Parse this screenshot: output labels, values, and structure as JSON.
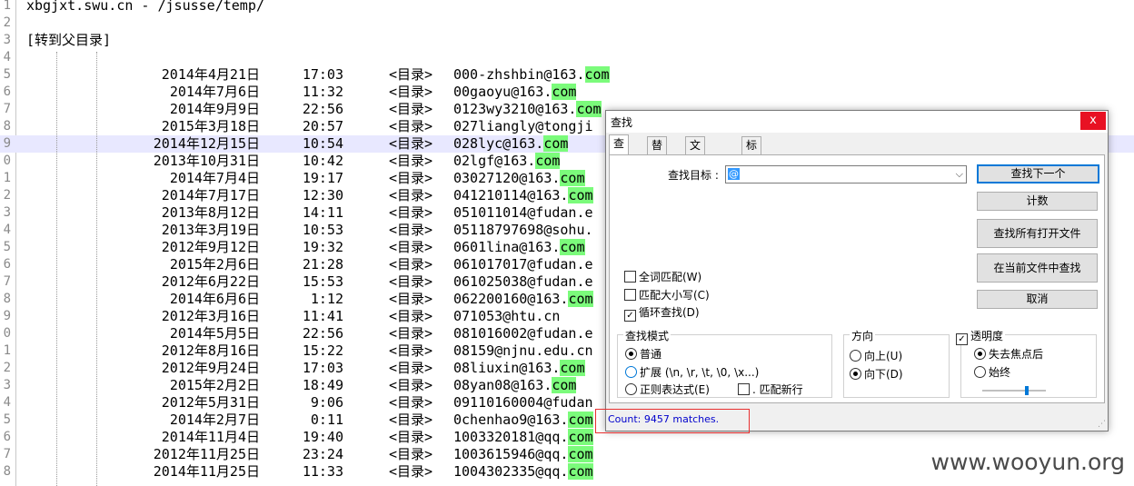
{
  "editor": {
    "header_line": "xbgjxt.swu.cn - /jsusse/temp/",
    "parent_link": "[转到父目录]",
    "dir_label": "<目录>",
    "highlight": "com",
    "current_line": 9,
    "rows": [
      {
        "ln": "5",
        "date": "2014年4月21日",
        "time": "17:03",
        "pre": "000-zhshbin@163.",
        "hl": true
      },
      {
        "ln": "6",
        "date": "2014年7月6日",
        "time": "11:32",
        "pre": "00gaoyu@163.",
        "hl": true
      },
      {
        "ln": "7",
        "date": "2014年9月9日",
        "time": "22:56",
        "pre": "0123wy3210@163.",
        "hl": true
      },
      {
        "ln": "8",
        "date": "2015年3月18日",
        "time": "20:57",
        "pre": "027liangly@tongji",
        "hl": false
      },
      {
        "ln": "9",
        "date": "2014年12月15日",
        "time": "10:54",
        "pre": "028lyc@163.",
        "hl": true
      },
      {
        "ln": "0",
        "date": "2013年10月31日",
        "time": "10:42",
        "pre": "02lgf@163.",
        "hl": true
      },
      {
        "ln": "1",
        "date": "2014年7月4日",
        "time": "19:17",
        "pre": "03027120@163.",
        "hl": true
      },
      {
        "ln": "2",
        "date": "2014年7月17日",
        "time": "12:30",
        "pre": "041210114@163.",
        "hl": true
      },
      {
        "ln": "3",
        "date": "2013年8月12日",
        "time": "14:11",
        "pre": "051011014@fudan.e",
        "hl": false
      },
      {
        "ln": "4",
        "date": "2013年3月19日",
        "time": "10:53",
        "pre": "05118797698@sohu.",
        "hl": false
      },
      {
        "ln": "5",
        "date": "2012年9月12日",
        "time": "19:32",
        "pre": "0601lina@163.",
        "hl": true
      },
      {
        "ln": "6",
        "date": "2015年2月6日",
        "time": "21:28",
        "pre": "061017017@fudan.e",
        "hl": false
      },
      {
        "ln": "7",
        "date": "2012年6月22日",
        "time": "15:53",
        "pre": "061025038@fudan.e",
        "hl": false
      },
      {
        "ln": "8",
        "date": "2014年6月6日",
        "time": "1:12",
        "pre": "062200160@163.",
        "hl": true
      },
      {
        "ln": "9",
        "date": "2012年3月16日",
        "time": "11:41",
        "pre": "071053@htu.cn",
        "hl": false
      },
      {
        "ln": "0",
        "date": "2014年5月5日",
        "time": "22:56",
        "pre": "081016002@fudan.e",
        "hl": false
      },
      {
        "ln": "1",
        "date": "2012年8月16日",
        "time": "15:22",
        "pre": "08159@njnu.edu.cn",
        "hl": false
      },
      {
        "ln": "2",
        "date": "2012年9月24日",
        "time": "17:03",
        "pre": "08liuxin@163.",
        "hl": true
      },
      {
        "ln": "3",
        "date": "2015年2月2日",
        "time": "18:49",
        "pre": "08yan08@163.",
        "hl": true
      },
      {
        "ln": "4",
        "date": "2012年5月31日",
        "time": "9:06",
        "pre": "09110160004@fudan",
        "hl": false
      },
      {
        "ln": "5",
        "date": "2014年2月7日",
        "time": "0:11",
        "pre": "0chenhao9@163.",
        "hl": true
      },
      {
        "ln": "6",
        "date": "2014年11月4日",
        "time": "19:40",
        "pre": "1003320181@qq.",
        "hl": true
      },
      {
        "ln": "7",
        "date": "2012年11月25日",
        "time": "23:24",
        "pre": "1003615946@qq.",
        "hl": true
      },
      {
        "ln": "8",
        "date": "2014年11月25日",
        "time": "11:33",
        "pre": "1004302335@qq.",
        "hl": true
      }
    ]
  },
  "watermark": "www.wooyun.org",
  "dialog": {
    "title": "查找",
    "close_glyph": "x",
    "tabs": [
      "查找",
      "替换",
      "文件查找",
      "标记"
    ],
    "find_label": "查找目标 :",
    "find_value": "@",
    "buttons": {
      "find_next": "查找下一个",
      "count": "计数",
      "find_all_open": "查找所有打开文件",
      "find_in_current": "在当前文件中查找",
      "cancel": "取消"
    },
    "checks": {
      "whole_word": "全词匹配(W)",
      "match_case": "匹配大小写(C)",
      "wrap": "循环查找(D)"
    },
    "mode": {
      "title": "查找模式",
      "normal": "普通",
      "extended": "扩展 (\\n, \\r, \\t, \\0, \\x...)",
      "regex": "正则表达式(E)",
      "dot_newline": ". 匹配新行"
    },
    "direction": {
      "title": "方向",
      "up": "向上(U)",
      "down": "向下(D)"
    },
    "transparency": {
      "title": "透明度",
      "on_lose_focus": "失去焦点后",
      "always": "始终"
    },
    "status": "Count: 9457 matches."
  }
}
